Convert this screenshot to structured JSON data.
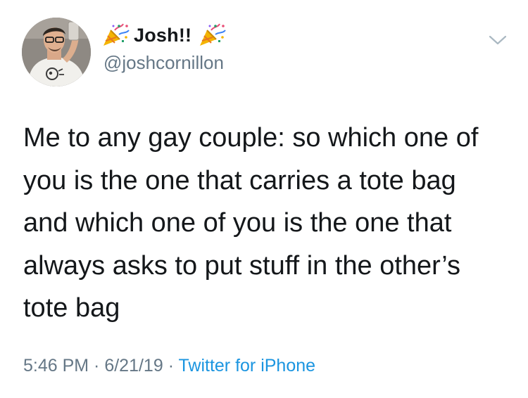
{
  "tweet": {
    "display_name": "Josh!!",
    "handle": "@joshcornillon",
    "text_lines": [
      "Me to any gay couple: so which one of",
      "you is the one that carries a tote bag",
      "and which one of you is the one that",
      "always asks to put stuff in the other’s",
      "tote bag"
    ],
    "time": "5:46 PM",
    "separator": " · ",
    "date": "6/21/19",
    "source": "Twitter for iPhone"
  },
  "icons": {
    "name_prefix": "party-popper-icon",
    "name_suffix": "party-popper-icon",
    "menu": "chevron-down-icon"
  },
  "colors": {
    "text": "#14171a",
    "secondary": "#657786",
    "link": "#1b95e0"
  }
}
